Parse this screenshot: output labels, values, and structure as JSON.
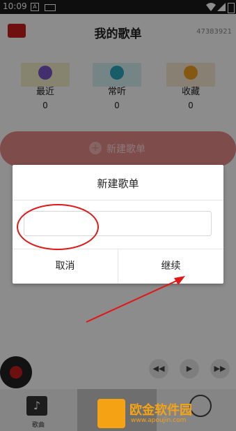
{
  "status_bar": {
    "time": "10:09",
    "a_icon": "A"
  },
  "header": {
    "title": "我的歌单",
    "user_id": "47383921"
  },
  "categories": [
    {
      "label": "最近",
      "count": "0",
      "color": "#f5f0c8",
      "dot": "#7a55c8"
    },
    {
      "label": "常听",
      "count": "0",
      "color": "#d6f2f2",
      "dot": "#2aa8c0"
    },
    {
      "label": "收藏",
      "count": "0",
      "color": "#f7ead0",
      "dot": "#f0a020"
    }
  ],
  "new_playlist_button": {
    "label": "新建歌单"
  },
  "player": {
    "prev": "◀◀",
    "play": "▶",
    "next": "▶▶"
  },
  "tabbar": {
    "songs_label": "歌曲"
  },
  "dialog": {
    "title": "新建歌单",
    "input_value": "",
    "input_placeholder": "",
    "cancel_label": "取消",
    "continue_label": "继续"
  },
  "watermark": {
    "text": "欧金软件园",
    "url": "www.apoujin.com"
  },
  "colors": {
    "brand": "#c81e1e",
    "annotation": "#e01818"
  }
}
